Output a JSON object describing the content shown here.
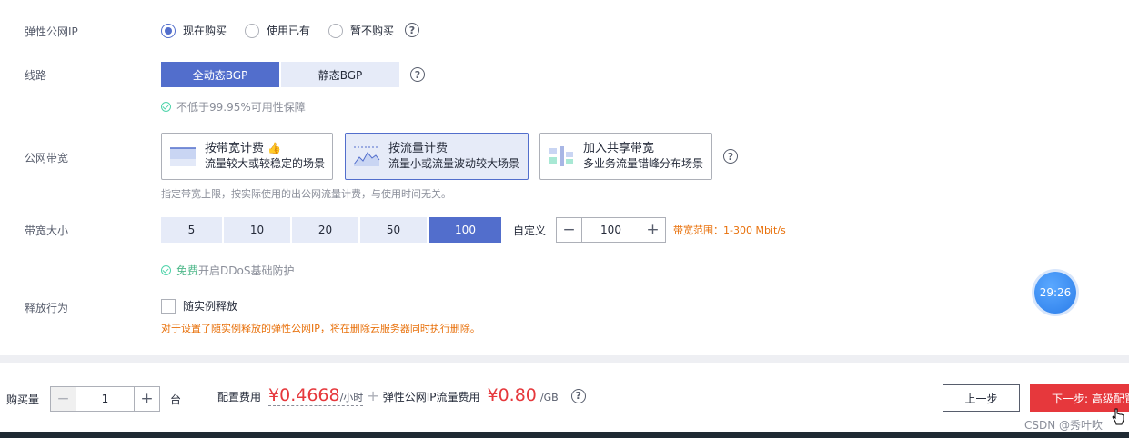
{
  "eip": {
    "label": "弹性公网IP",
    "options": [
      "现在购买",
      "使用已有",
      "暂不购买"
    ],
    "selected_index": 0
  },
  "line": {
    "label": "线路",
    "options": [
      "全动态BGP",
      "静态BGP"
    ],
    "selected_index": 0,
    "tip": "不低于99.95%可用性保障"
  },
  "bandwidth": {
    "label": "公网带宽",
    "cards": [
      {
        "title": "按带宽计费",
        "desc": "流量较大或较稳定的场景",
        "icon": "bar-chart-icon"
      },
      {
        "title": "按流量计费",
        "desc": "流量小或流量波动较大场景",
        "icon": "area-chart-icon"
      },
      {
        "title": "加入共享带宽",
        "desc": "多业务流量错峰分布场景",
        "icon": "shared-bandwidth-icon"
      }
    ],
    "selected_index": 1,
    "hint": "指定带宽上限，按实际使用的出公网流量计费，与使用时间无关。"
  },
  "size": {
    "label": "带宽大小",
    "options": [
      "5",
      "10",
      "20",
      "50",
      "100"
    ],
    "selected_index": 4,
    "custom_label": "自定义",
    "custom_value": "100",
    "range_text": "带宽范围：1-300 Mbit/s",
    "ddos_free": "免费",
    "ddos_text": "开启DDoS基础防护"
  },
  "release": {
    "label": "释放行为",
    "checkbox_label": "随实例释放",
    "warning": "对于设置了随实例释放的弹性公网IP，将在删除云服务器同时执行删除。"
  },
  "timer": "29:26",
  "footer": {
    "qty_label": "购买量",
    "qty_value": "1",
    "qty_unit": "台",
    "config_fee_label": "配置费用",
    "config_price": "¥0.4668",
    "config_unit": "/小时",
    "plus": "+",
    "eip_fee_label": "弹性公网IP流量费用",
    "eip_price": "¥0.80",
    "eip_unit": "/GB",
    "prev_label": "上一步",
    "next_label": "下一步: 高级配置",
    "watermark": "CSDN @秀叶吹"
  },
  "colors": {
    "accent": "#526ecc",
    "danger": "#e6383c",
    "warning": "#e8700a",
    "success": "#50d4ab"
  }
}
